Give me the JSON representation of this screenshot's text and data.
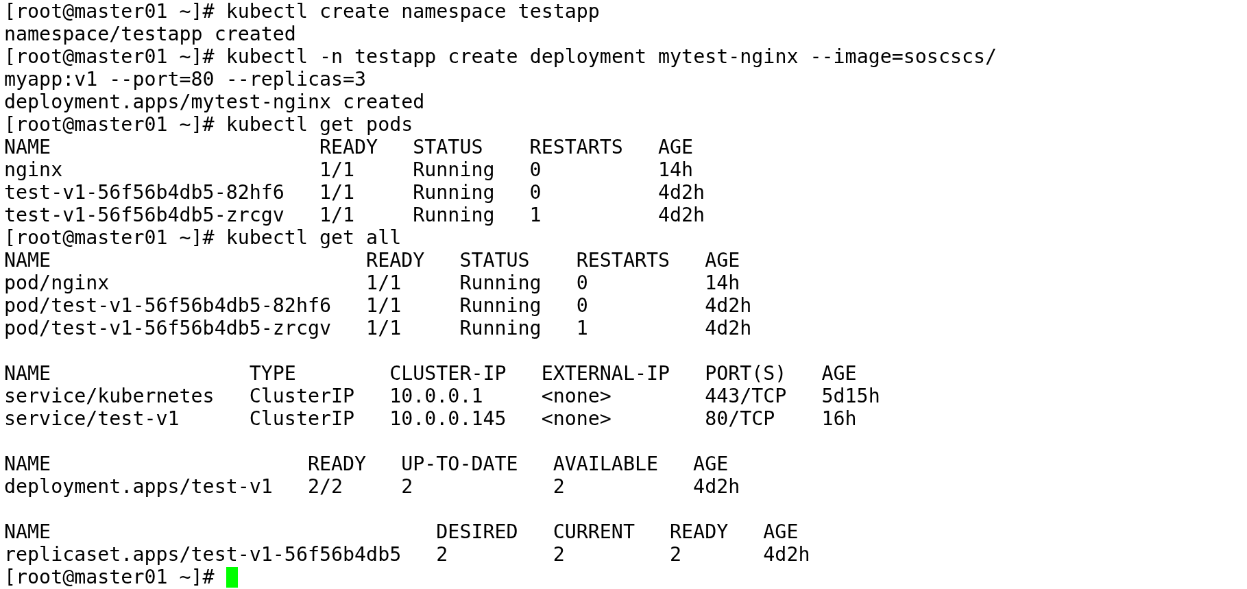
{
  "terminal": {
    "lines": [
      {
        "kind": "command",
        "prompt": "[root@master01 ~]#",
        "text": "kubectl create namespace testapp"
      },
      {
        "kind": "output",
        "text": "namespace/testapp created"
      },
      {
        "kind": "command",
        "prompt": "[root@master01 ~]#",
        "text": "kubectl -n testapp create deployment mytest-nginx --image=soscscs/"
      },
      {
        "kind": "output",
        "text": "myapp:v1 --port=80 --replicas=3"
      },
      {
        "kind": "output",
        "text": "deployment.apps/mytest-nginx created"
      },
      {
        "kind": "command",
        "prompt": "[root@master01 ~]#",
        "text": "kubectl get pods"
      },
      {
        "kind": "table",
        "columns": [
          "NAME",
          "READY",
          "STATUS",
          "RESTARTS",
          "AGE"
        ],
        "rows": [
          [
            "nginx",
            "1/1",
            "Running",
            "0",
            "14h"
          ],
          [
            "test-v1-56f56b4db5-82hf6",
            "1/1",
            "Running",
            "0",
            "4d2h"
          ],
          [
            "test-v1-56f56b4db5-zrcgv",
            "1/1",
            "Running",
            "1",
            "4d2h"
          ]
        ]
      },
      {
        "kind": "command",
        "prompt": "[root@master01 ~]#",
        "text": "kubectl get all"
      },
      {
        "kind": "table",
        "columns": [
          "NAME",
          "READY",
          "STATUS",
          "RESTARTS",
          "AGE"
        ],
        "rows": [
          [
            "pod/nginx",
            "1/1",
            "Running",
            "0",
            "14h"
          ],
          [
            "pod/test-v1-56f56b4db5-82hf6",
            "1/1",
            "Running",
            "0",
            "4d2h"
          ],
          [
            "pod/test-v1-56f56b4db5-zrcgv",
            "1/1",
            "Running",
            "1",
            "4d2h"
          ]
        ]
      },
      {
        "kind": "blank"
      },
      {
        "kind": "table",
        "columns": [
          "NAME",
          "TYPE",
          "CLUSTER-IP",
          "EXTERNAL-IP",
          "PORT(S)",
          "AGE"
        ],
        "rows": [
          [
            "service/kubernetes",
            "ClusterIP",
            "10.0.0.1",
            "<none>",
            "443/TCP",
            "5d15h"
          ],
          [
            "service/test-v1",
            "ClusterIP",
            "10.0.0.145",
            "<none>",
            "80/TCP",
            "16h"
          ]
        ]
      },
      {
        "kind": "blank"
      },
      {
        "kind": "table",
        "columns": [
          "NAME",
          "READY",
          "UP-TO-DATE",
          "AVAILABLE",
          "AGE"
        ],
        "rows": [
          [
            "deployment.apps/test-v1",
            "2/2",
            "2",
            "2",
            "4d2h"
          ]
        ]
      },
      {
        "kind": "blank"
      },
      {
        "kind": "table",
        "columns": [
          "NAME",
          "DESIRED",
          "CURRENT",
          "READY",
          "AGE"
        ],
        "rows": [
          [
            "replicaset.apps/test-v1-56f56b4db5",
            "2",
            "2",
            "2",
            "4d2h"
          ]
        ]
      },
      {
        "kind": "command",
        "prompt": "[root@master01 ~]#",
        "cursor": true
      }
    ]
  }
}
